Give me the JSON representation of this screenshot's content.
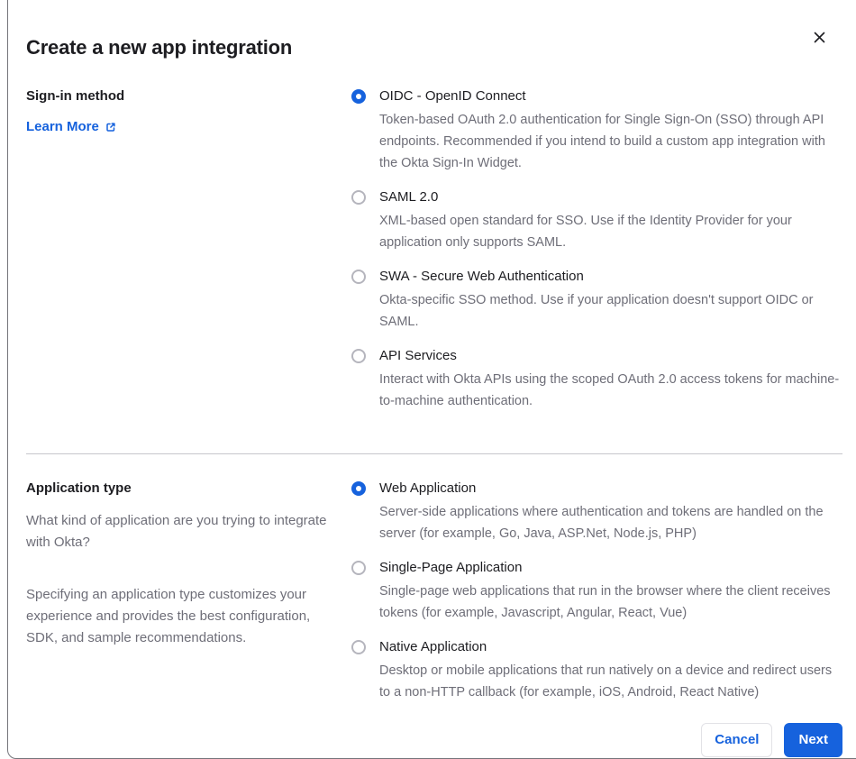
{
  "modal": {
    "title": "Create a new app integration"
  },
  "colors": {
    "primary_blue": "#1662dd",
    "text_dark": "#1d1d21",
    "text_gray": "#6e6e78",
    "divider": "#c6c6cc"
  },
  "signin_section": {
    "heading": "Sign-in method",
    "learn_more_label": "Learn More",
    "options": [
      {
        "label": "OIDC - OpenID Connect",
        "description": "Token-based OAuth 2.0 authentication for Single Sign-On (SSO) through API endpoints. Recommended if you intend to build a custom app integration with the Okta Sign-In Widget.",
        "selected": true
      },
      {
        "label": "SAML 2.0",
        "description": "XML-based open standard for SSO. Use if the Identity Provider for your application only supports SAML.",
        "selected": false
      },
      {
        "label": "SWA - Secure Web Authentication",
        "description": "Okta-specific SSO method. Use if your application doesn't support OIDC or SAML.",
        "selected": false
      },
      {
        "label": "API Services",
        "description": "Interact with Okta APIs using the scoped OAuth 2.0 access tokens for machine-to-machine authentication.",
        "selected": false
      }
    ]
  },
  "apptype_section": {
    "heading": "Application type",
    "paragraphs": [
      "What kind of application are you trying to integrate with Okta?",
      "Specifying an application type customizes your experience and provides the best configuration, SDK, and sample recommendations."
    ],
    "options": [
      {
        "label": "Web Application",
        "description": "Server-side applications where authentication and tokens are handled on the server (for example, Go, Java, ASP.Net, Node.js, PHP)",
        "selected": true
      },
      {
        "label": "Single-Page Application",
        "description": "Single-page web applications that run in the browser where the client receives tokens (for example, Javascript, Angular, React, Vue)",
        "selected": false
      },
      {
        "label": "Native Application",
        "description": "Desktop or mobile applications that run natively on a device and redirect users to a non-HTTP callback (for example, iOS, Android, React Native)",
        "selected": false
      }
    ]
  },
  "footer": {
    "cancel_label": "Cancel",
    "next_label": "Next"
  }
}
